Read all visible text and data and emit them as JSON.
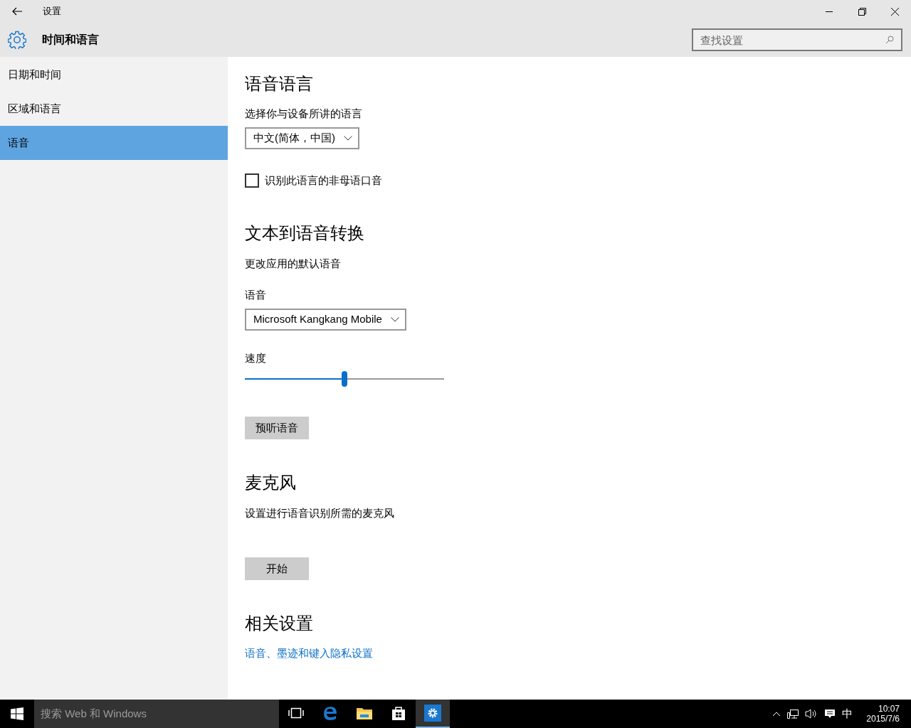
{
  "window": {
    "title": "设置"
  },
  "header": {
    "title": "时间和语言",
    "search_placeholder": "查找设置"
  },
  "sidebar": {
    "items": [
      {
        "label": "日期和时间",
        "selected": false
      },
      {
        "label": "区域和语言",
        "selected": false
      },
      {
        "label": "语音",
        "selected": true
      }
    ]
  },
  "content": [
    {
      "kind": "heading",
      "text": "语音语言"
    },
    {
      "kind": "label",
      "text": "选择你与设备所讲的语言"
    },
    {
      "kind": "dropdown",
      "value": "中文(简体，中国)"
    },
    {
      "kind": "checkbox",
      "label": "识别此语言的非母语口音",
      "checked": false
    },
    {
      "kind": "heading",
      "text": "文本到语音转换"
    },
    {
      "kind": "label",
      "text": "更改应用的默认语音"
    },
    {
      "kind": "label",
      "text": "语音"
    },
    {
      "kind": "dropdown",
      "value": "Microsoft Kangkang Mobile"
    },
    {
      "kind": "label",
      "text": "速度"
    },
    {
      "kind": "slider",
      "level": 0.5
    },
    {
      "kind": "button",
      "label": "预听语音"
    },
    {
      "kind": "heading",
      "text": "麦克风"
    },
    {
      "kind": "label",
      "text": "设置进行语音识别所需的麦克风"
    },
    {
      "kind": "button",
      "label": "开始"
    },
    {
      "kind": "heading",
      "text": "相关设置"
    },
    {
      "kind": "link",
      "text": "语音、墨迹和键入隐私设置"
    }
  ],
  "taskbar": {
    "search_placeholder": "搜索 Web 和 Windows",
    "apps": [
      {
        "kind": "taskview",
        "active": false
      },
      {
        "kind": "edge",
        "active": false
      },
      {
        "kind": "explorer",
        "active": false
      },
      {
        "kind": "store",
        "active": false
      },
      {
        "kind": "settings",
        "active": true
      }
    ],
    "tray": {
      "ime": "中",
      "time": "10:07",
      "date": "2015/7/6"
    }
  }
}
